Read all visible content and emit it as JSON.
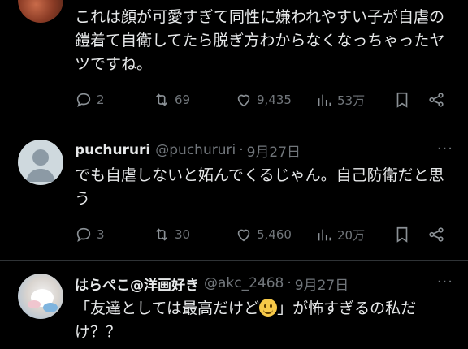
{
  "tweets": [
    {
      "text": "これは顔が可愛すぎて同性に嫌われやすい子が自虐の鎧着て自衛してたら脱ぎ方わからなくなっちゃったヤツですね。",
      "replies": "2",
      "retweets": "69",
      "likes": "9,435",
      "views": "53万"
    },
    {
      "name": "puchururi",
      "handle": "@puchururi",
      "separator": "·",
      "date": "9月27日",
      "text": "でも自虐しないと妬んでくるじゃん。自己防衛だと思う",
      "replies": "3",
      "retweets": "30",
      "likes": "5,460",
      "views": "20万"
    },
    {
      "name": "はらぺこ@洋画好き",
      "handle": "@akc_2468",
      "separator": "·",
      "date": "9月27日",
      "text_before": "「友達としては最高だけど",
      "text_after": "」が怖すぎるの私だけ？？",
      "emoji": "grinning-face-emoji"
    }
  ],
  "more_label": "···",
  "colors": {
    "background": "#000000",
    "text": "#e7e9ea",
    "muted": "#71767b",
    "divider": "#2f3336"
  }
}
